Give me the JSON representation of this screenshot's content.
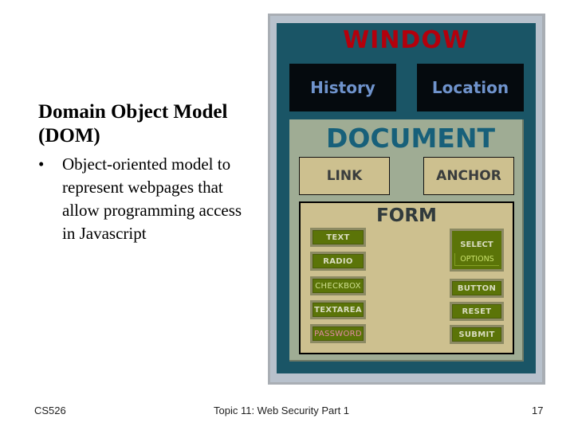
{
  "slide": {
    "title": "Domain Object Model (DOM)",
    "bullets": [
      {
        "marker": "•",
        "text": "Object-oriented model to represent  webpages that allow programming access in Javascript"
      }
    ]
  },
  "footer": {
    "course": "CS526",
    "topic": "Topic 11: Web Security Part 1",
    "page_number": "17"
  },
  "diagram": {
    "window": {
      "label": "WINDOW",
      "children": [
        "History",
        "Location"
      ]
    },
    "document": {
      "label": "DOCUMENT",
      "children": [
        "LINK",
        "ANCHOR"
      ]
    },
    "form": {
      "label": "FORM",
      "left_elements": [
        "TEXT",
        "RADIO",
        "CHECKBOX",
        "TEXTAREA",
        "PASSWORD"
      ],
      "select": {
        "label": "SELECT",
        "sub_label": "OPTIONS"
      },
      "right_elements": [
        "BUTTON",
        "RESET",
        "SUBMIT"
      ]
    },
    "colors": {
      "window_bg": "#1a5566",
      "window_label": "#b3000c",
      "window_child_bg": "#050a0e",
      "window_child_text": "#6f93cc",
      "document_bg": "#9fac94",
      "document_label": "#17607a",
      "tan_box": "#cdc08f",
      "form_element_bg": "#5b7408",
      "password_text": "#e38aa6"
    }
  }
}
